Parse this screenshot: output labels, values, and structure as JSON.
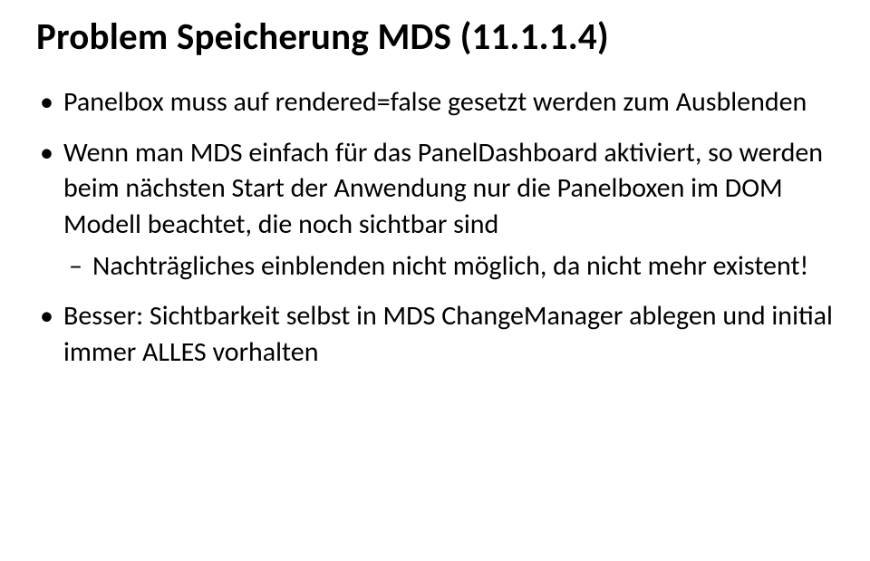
{
  "title": "Problem Speicherung MDS (11.1.1.4)",
  "bullets": [
    {
      "text": "Panelbox muss auf rendered=false gesetzt werden zum Ausblenden"
    },
    {
      "text": "Wenn man MDS einfach für das PanelDashboard aktiviert, so werden beim nächsten Start der Anwendung nur die Panelboxen im DOM Modell beachtet, die noch sichtbar sind",
      "children": [
        {
          "text": "Nachträgliches einblenden nicht möglich, da nicht mehr existent!"
        }
      ]
    },
    {
      "text": "Besser: Sichtbarkeit selbst in MDS ChangeManager ablegen und initial immer ALLES vorhalten"
    }
  ]
}
